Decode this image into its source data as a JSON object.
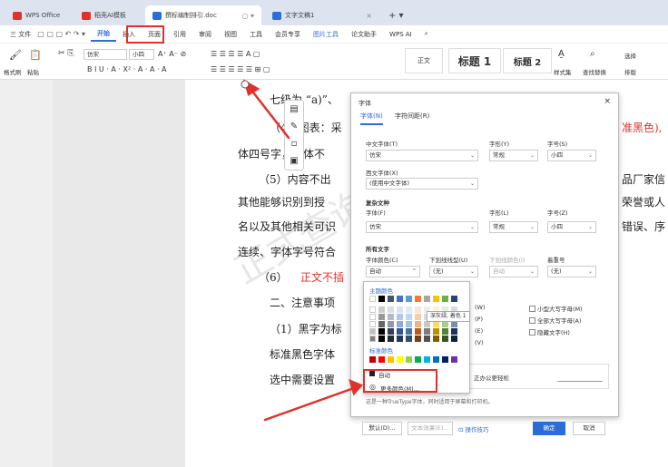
{
  "tabs": {
    "wps": "WPS Office",
    "template": "稻壳AI模板",
    "doc_active": "撰标编制排引.doc",
    "doc2": "文字文稿1"
  },
  "menu": [
    "三 文件",
    "开始",
    "插入",
    "页面",
    "引用",
    "审阅",
    "视图",
    "工具",
    "会员专享",
    "图片工具",
    "论文助手",
    "WPS AI"
  ],
  "ribbon": {
    "format_painter": "格式刷",
    "paste": "粘贴",
    "font_name": "仿宋",
    "font_size": "小四",
    "style_normal": "正文",
    "style_h1": "标题 1",
    "style_h2": "标题 2",
    "styles": "样式集",
    "find": "查找替换",
    "select": "选择",
    "typeset": "排版"
  },
  "doc": {
    "l1": "七级为 “a)”、",
    "l2": "（4）图表：采",
    "l2r": "准黑色),",
    "l3": "体四号字，字体不",
    "l4": "（5）内容不出",
    "l4r": "品厂家信",
    "l5": "其他能够识别到授",
    "l5r": "荣誉或人",
    "l6": "名以及其他相关可识",
    "l6r": "错误、序",
    "l7": "连续、字体字号符合",
    "l8_prefix": "（6）",
    "l8_red": "正文不插",
    "l9": "二、注意事项",
    "l10": "（1）黑字为标",
    "l11": "标准黑色字体",
    "l12": "选中需要设置"
  },
  "dialog": {
    "title": "字体",
    "tab_font": "字体(N)",
    "tab_spacing": "字符间距(R)",
    "cn_font_label": "中文字体(T)",
    "cn_font": "仿宋",
    "style_label": "字形(Y)",
    "style": "常规",
    "size_label": "字号(S)",
    "size": "小四",
    "west_font_label": "西文字体(X)",
    "west_font": "(使用中文字体)",
    "complex_section": "复杂文种",
    "cx_font_label": "字体(F)",
    "cx_font": "仿宋",
    "cx_style_label": "字形(L)",
    "cx_style": "常规",
    "cx_size_label": "字号(Z)",
    "cx_size": "小四",
    "all_text": "所有文字",
    "color_label": "字体颜色(C)",
    "color": "自动",
    "underline_label": "下划线线型(U)",
    "underline": "(无)",
    "ul_color_label": "下划线颜色(I)",
    "ul_color": "自动",
    "emphasis_label": "着重号",
    "emphasis": "(无)",
    "eff_w": "(W)",
    "eff_p": "(P)",
    "eff_e": "(E)",
    "eff_v": "(V)",
    "small_caps": "小型大写字母(M)",
    "all_caps": "全部大写字母(A)",
    "hidden": "隐藏文字(H)",
    "preview_text": "正办公更轻松",
    "hint": "这是一种TrueType字体，同时适用于屏幕和打印机。",
    "default_btn": "默认(D)...",
    "effects_btn": "文本效果(E)...",
    "tips_btn": "操作技巧",
    "ok_btn": "确定",
    "cancel_btn": "取消"
  },
  "color_popup": {
    "theme": "主题颜色",
    "standard": "标准颜色",
    "auto": "自动",
    "more": "更多颜色(M)...",
    "tooltip": "深灰绿, 着色 1"
  },
  "watermark": "正式查询",
  "colors": {
    "accent": "#2b6cd8",
    "red": "#e0322b"
  }
}
